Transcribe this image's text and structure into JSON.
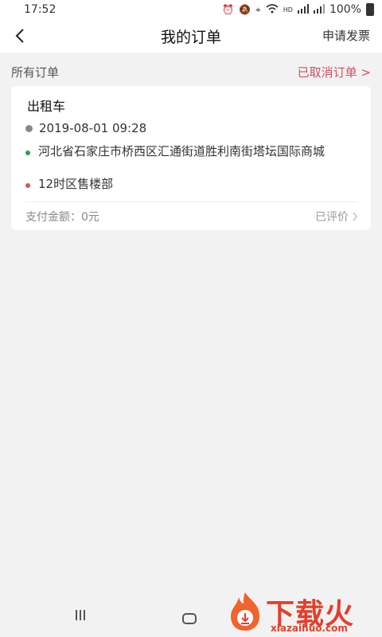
{
  "status_bar": {
    "time": "17:52",
    "battery": "100%",
    "icons": [
      "alarm-icon",
      "mute-icon",
      "location-icon",
      "wifi-icon",
      "hd-icon",
      "signal-4g-icon",
      "signal-2g-icon",
      "battery-icon"
    ]
  },
  "header": {
    "back_icon": "chevron-left-icon",
    "title": "我的订单",
    "invoice_label": "申请发票"
  },
  "section": {
    "title": "所有订单",
    "cancelled_label": "已取消订单 >"
  },
  "order": {
    "type": "出租车",
    "time": "2019-08-01 09:28",
    "from": "河北省石家庄市桥西区汇通街道胜利南街塔坛国际商城",
    "to": "12时区售楼部",
    "payment": "支付金额：0元",
    "status": "已评价",
    "colors": {
      "from_dot": "#2f9b5a",
      "to_dot": "#d05a5a"
    }
  },
  "nav": {
    "icons": [
      "recent-apps-icon",
      "home-icon"
    ]
  },
  "watermark": {
    "title": "下载火",
    "url": "xiazaihuo.com"
  },
  "colors": {
    "accent": "#d0505f",
    "background": "#f2f2f2",
    "card": "#ffffff"
  }
}
